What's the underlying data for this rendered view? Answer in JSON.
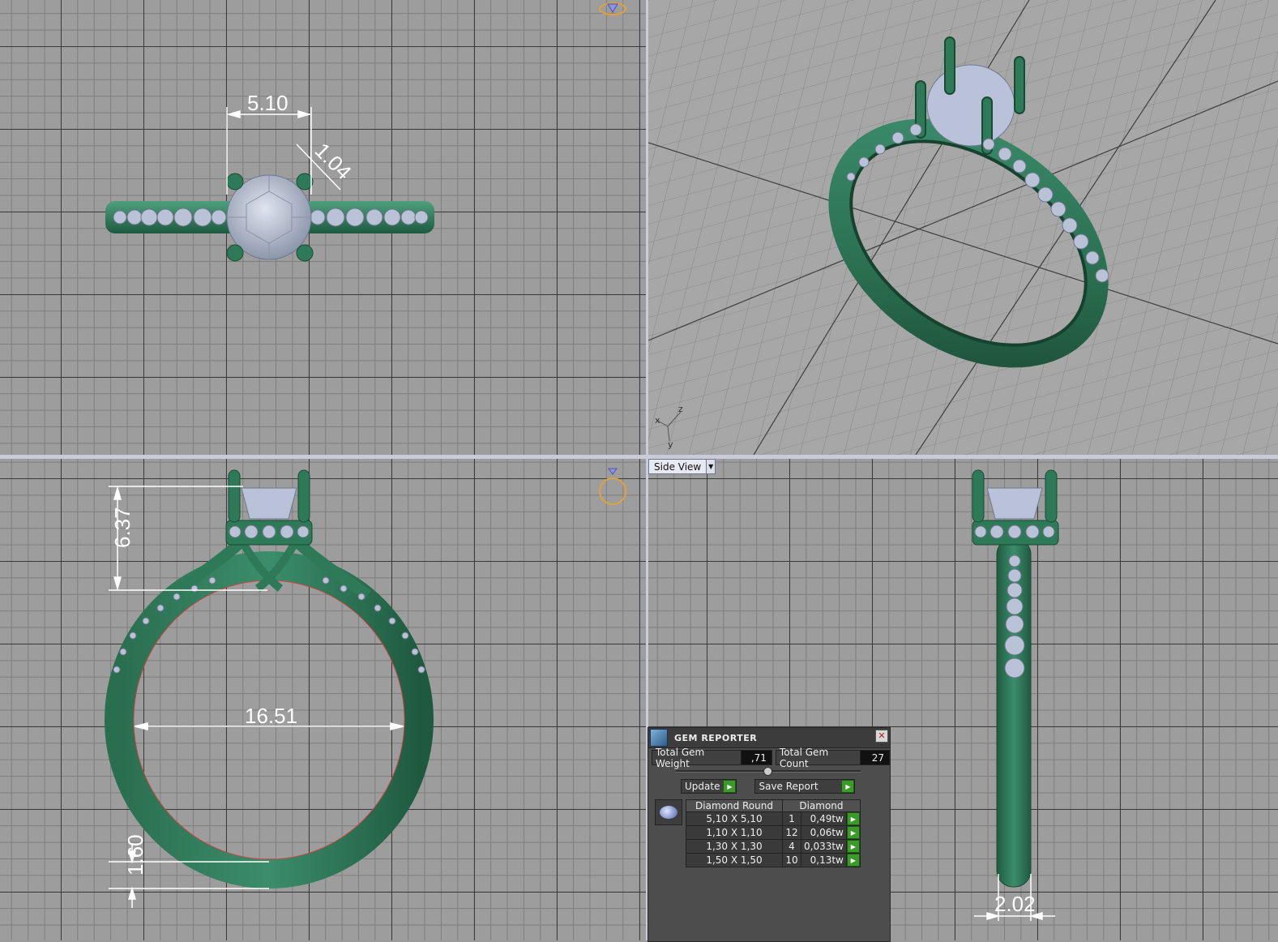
{
  "viewports": {
    "top": {
      "dimensions": [
        "5.10",
        "1.04"
      ]
    },
    "front": {
      "dimensions": [
        "6.37",
        "16.51",
        "1.60"
      ]
    },
    "side": {
      "view_label": "Side View",
      "dimensions": [
        "2.02"
      ]
    },
    "perspective": {
      "axes": [
        "x",
        "z",
        "y"
      ]
    }
  },
  "gem_reporter": {
    "title": "GEM REPORTER",
    "close_icon": "close-icon",
    "total_gem_weight_label": "Total Gem Weight",
    "total_gem_weight": ",71",
    "total_gem_count_label": "Total Gem Count",
    "total_gem_count": "27",
    "update_label": "Update",
    "save_report_label": "Save Report",
    "table": {
      "headers": [
        "Diamond Round",
        "Diamond"
      ],
      "rows": [
        {
          "size": "5,10 X 5,10",
          "count": "1",
          "weight": "0,49tw"
        },
        {
          "size": "1,10 X 1,10",
          "count": "12",
          "weight": "0,06tw"
        },
        {
          "size": "1,30 X 1,30",
          "count": "4",
          "weight": "0,033tw"
        },
        {
          "size": "1,50 X 1,50",
          "count": "10",
          "weight": "0,13tw"
        }
      ]
    }
  },
  "colors": {
    "metal": "#2e7a58",
    "gem": "#b7c0d4",
    "grid_bg": "#9d9d9d",
    "accent_green": "#3c9a2a"
  }
}
